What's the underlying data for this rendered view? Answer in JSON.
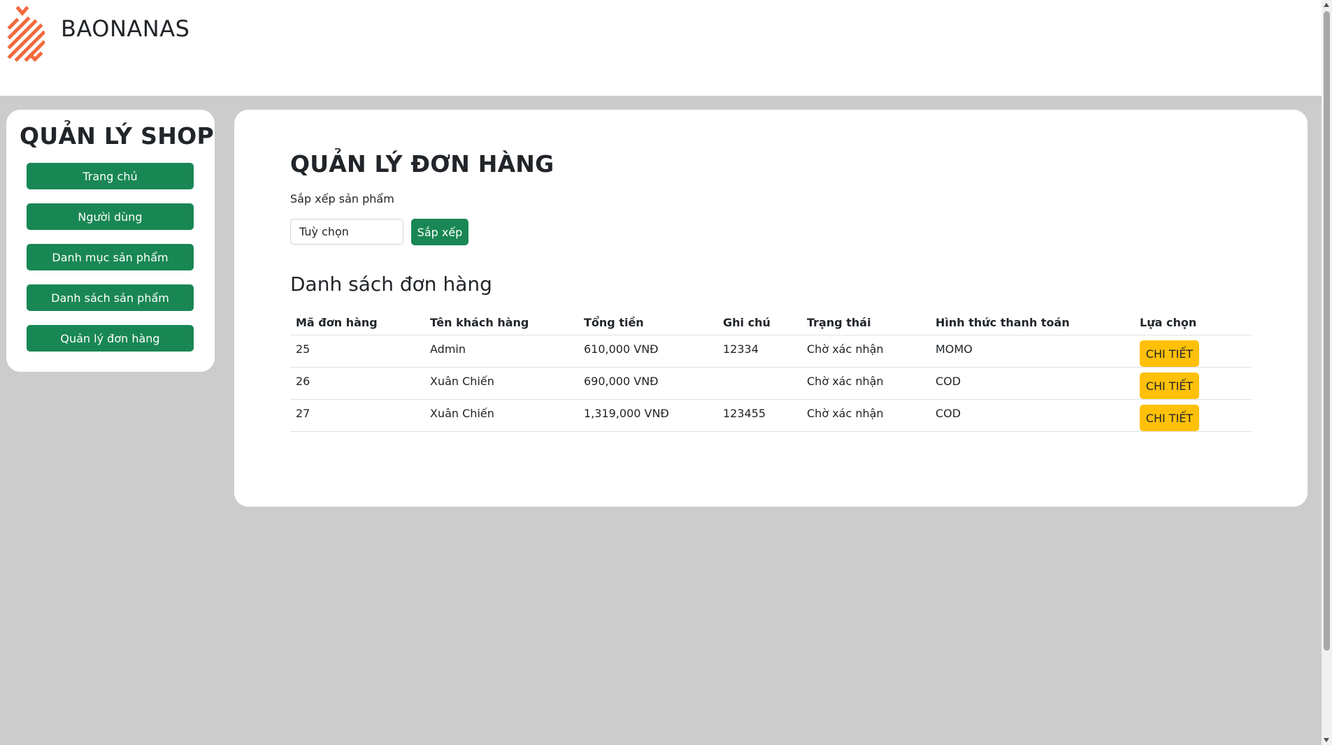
{
  "header": {
    "brand": "BAONANAS",
    "accent_color": "#f26a3d"
  },
  "sidebar": {
    "title": "QUẢN LÝ SHOP",
    "items": [
      {
        "label": "Trang chủ"
      },
      {
        "label": "Người dùng"
      },
      {
        "label": "Danh mục sản phẩm"
      },
      {
        "label": "Danh sách sản phẩm"
      },
      {
        "label": "Quản lý đơn hàng"
      }
    ],
    "button_color": "#198754"
  },
  "main": {
    "title": "QUẢN LÝ ĐƠN HÀNG",
    "sort": {
      "label": "Sắp xếp sản phẩm",
      "select_value": "Tuỳ chọn",
      "button_label": "Sắp xếp"
    },
    "orders": {
      "title": "Danh sách đơn hàng",
      "columns": [
        "Mã đơn hàng",
        "Tên khách hàng",
        "Tổng tiền",
        "Ghi chú",
        "Trạng thái",
        "Hình thức thanh toán",
        "Lựa chọn"
      ],
      "rows": [
        {
          "id": "25",
          "customer": "Admin",
          "total": "610,000 VNĐ",
          "note": "12334",
          "status": "Chờ xác nhận",
          "payment": "MOMO",
          "action": "CHI TIẾT"
        },
        {
          "id": "26",
          "customer": "Xuân Chiến",
          "total": "690,000 VNĐ",
          "note": "",
          "status": "Chờ xác nhận",
          "payment": "COD",
          "action": "CHI TIẾT"
        },
        {
          "id": "27",
          "customer": "Xuân Chiến",
          "total": "1,319,000 VNĐ",
          "note": "123455",
          "status": "Chờ xác nhận",
          "payment": "COD",
          "action": "CHI TIẾT"
        }
      ],
      "action_color": "#ffc107"
    }
  }
}
